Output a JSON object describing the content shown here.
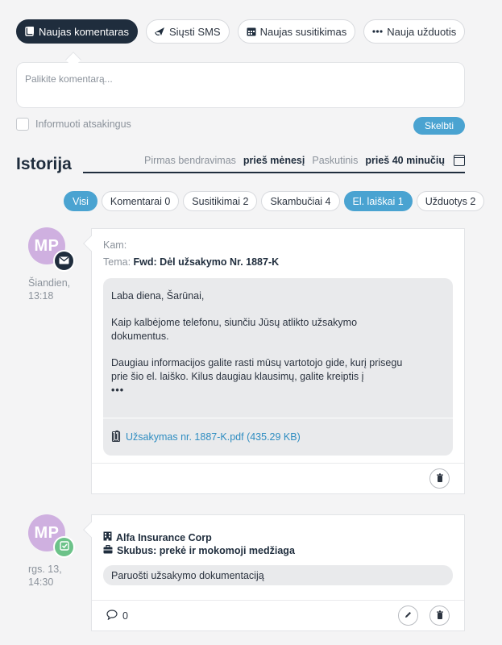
{
  "actions": [
    {
      "label": "Naujas komentaras",
      "icon": "comment-icon",
      "active": true
    },
    {
      "label": "Siųsti SMS",
      "icon": "send-icon",
      "active": false
    },
    {
      "label": "Naujas susitikimas",
      "icon": "calendar-icon",
      "active": false
    },
    {
      "label": "Nauja užduotis",
      "icon": "dots-icon",
      "active": false
    }
  ],
  "comment": {
    "placeholder": "Palikite komentarą..."
  },
  "notify_label": "Informuoti atsakingus",
  "publish_label": "Skelbti",
  "history": {
    "title": "Istorija",
    "first_label": "Pirmas bendravimas",
    "first_value": "prieš mėnesį",
    "last_label": "Paskutinis",
    "last_value": "prieš 40 minučių"
  },
  "filters": [
    {
      "label": "Visi",
      "selected": true
    },
    {
      "label": "Komentarai 0",
      "selected": false
    },
    {
      "label": "Susitikimai 2",
      "selected": false
    },
    {
      "label": "Skambučiai 4",
      "selected": false
    },
    {
      "label": "El. laiškai 1",
      "selected": true
    },
    {
      "label": "Užduotys 2",
      "selected": false
    }
  ],
  "items": {
    "email": {
      "initials": "MP",
      "time_line1": "Šiandien,",
      "time_line2": "13:18",
      "to_label": "Kam:",
      "subject_label": "Tema:",
      "subject": "Fwd: Dėl užsakymo Nr. 1887-K",
      "greeting": "Laba diena, Šarūnai,",
      "para1": "Kaip kalbėjome telefonu, siunčiu Jūsų atlikto užsakymo dokumentus.",
      "para2": "Daugiau informacijos galite rasti mūsų vartotojo gide, kurį prisegu prie šio el. laiško. Kilus daugiau klausimų, galite kreiptis į",
      "ellipsis": "•••",
      "attachment": "Užsakymas nr. 1887-K.pdf (435.29 KB)"
    },
    "task": {
      "initials": "MP",
      "time_line1": "rgs. 13,",
      "time_line2": "14:30",
      "company": "Alfa Insurance Corp",
      "deal": "Skubus: prekė ir mokomoji medžiaga",
      "task_text": "Paruošti užsakymo dokumentaciją",
      "comment_count": "0"
    }
  },
  "colors": {
    "accent": "#4aa3d1",
    "dark": "#1f2d3d",
    "avatar": "#cfb0e0",
    "task_badge": "#6cc289"
  }
}
